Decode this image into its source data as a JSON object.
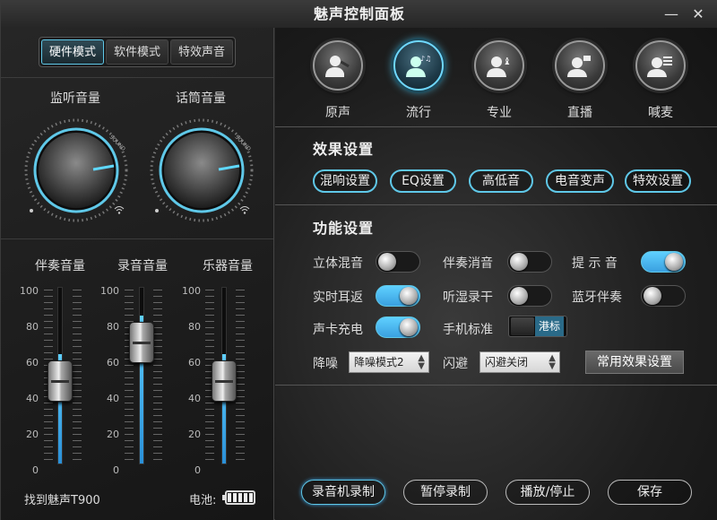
{
  "title": "魅声控制面板",
  "window_controls": {
    "minimize": "—",
    "close": "✕"
  },
  "mode_tabs": [
    {
      "label": "硬件模式",
      "active": true
    },
    {
      "label": "软件模式",
      "active": false
    },
    {
      "label": "特效声音",
      "active": false
    }
  ],
  "knobs": [
    {
      "label": "监听音量",
      "mark": "SOUND"
    },
    {
      "label": "话筒音量",
      "mark": "SOUND"
    }
  ],
  "faders": {
    "labels": [
      "伴奏音量",
      "录音音量",
      "乐器音量"
    ],
    "scale": [
      "100",
      "80",
      "60",
      "40",
      "20",
      "0"
    ],
    "levels_percent": [
      62,
      84,
      62
    ]
  },
  "status": {
    "device": "找到魅声T900",
    "battery_label": "电池:"
  },
  "sound_modes": [
    {
      "label": "原声",
      "icon": "person-mic-icon",
      "active": false
    },
    {
      "label": "流行",
      "icon": "person-music-icon",
      "active": true
    },
    {
      "label": "专业",
      "icon": "person-chess-icon",
      "active": false
    },
    {
      "label": "直播",
      "icon": "person-broadcast-icon",
      "active": false
    },
    {
      "label": "喊麦",
      "icon": "person-equalizer-icon",
      "active": false
    }
  ],
  "effects": {
    "title": "效果设置",
    "buttons": [
      "混响设置",
      "EQ设置",
      "高低音",
      "电音变声",
      "特效设置"
    ]
  },
  "functions": {
    "title": "功能设置",
    "toggles": [
      {
        "label": "立体混音",
        "on": false
      },
      {
        "label": "伴奏消音",
        "on": false
      },
      {
        "label": "提 示 音",
        "on": true
      },
      {
        "label": "实时耳返",
        "on": true
      },
      {
        "label": "听湿录干",
        "on": false
      },
      {
        "label": "蓝牙伴奏",
        "on": false
      },
      {
        "label": "声卡充电",
        "on": true
      }
    ],
    "phone_std_label": "手机标准",
    "phone_std_value": "港标",
    "noise_label": "降噪",
    "noise_value": "降噪模式2",
    "dodge_label": "闪避",
    "dodge_value": "闪避关闭",
    "common_button": "常用效果设置"
  },
  "bottom_buttons": [
    {
      "label": "录音机录制",
      "active": true
    },
    {
      "label": "暂停录制",
      "active": false
    },
    {
      "label": "播放/停止",
      "active": false
    },
    {
      "label": "保存",
      "active": false
    }
  ],
  "colors": {
    "accent": "#5fc8e8",
    "fill": "#3aa0e0"
  }
}
